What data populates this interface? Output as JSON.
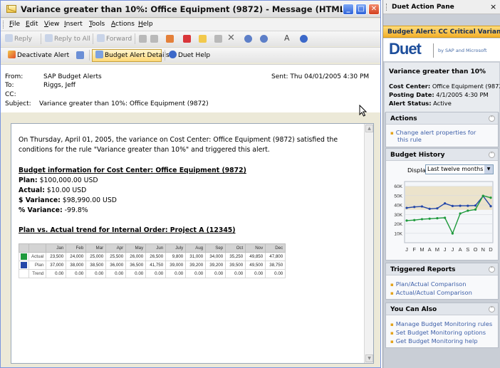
{
  "window": {
    "title": "Variance greater than 10%: Office Equipment (9872) - Message (HTML)",
    "min_glyph": "_",
    "max_glyph": "□",
    "close_glyph": "✕"
  },
  "menu": [
    "File",
    "Edit",
    "View",
    "Insert",
    "Tools",
    "Actions",
    "Help"
  ],
  "toolbar1": {
    "reply": "Reply",
    "reply_all": "Reply to All",
    "forward": "Forward",
    "font_glyph": "A"
  },
  "toolbar2": {
    "deactivate": "Deactivate Alert",
    "details": "Budget Alert Details",
    "help": "Duet Help"
  },
  "header": {
    "from_label": "From:",
    "from": "SAP Budget Alerts",
    "to_label": "To:",
    "to": "Riggs, Jeff",
    "cc_label": "CC:",
    "cc": "",
    "subject_label": "Subject:",
    "subject": "Variance greater than 10%: Office Equipment (9872)",
    "sent": "Sent: Thu 04/01/2005 4:30 PM"
  },
  "body": {
    "intro": "On Thursday, April 01, 2005, the variance on Cost Center: Office Equipment (9872) satisfied the conditions for the rule \"Variance greater than 10%\" and triggered this alert.",
    "budget_heading": "Budget information for Cost Center: Office Equipment (9872)",
    "plan_label": "Plan:",
    "plan": " $100,000.00 USD",
    "actual_label": "Actual:",
    "actual": " $10.00 USD",
    "var_label": "$ Variance:",
    "var": " $98,990.00 USD",
    "pct_label": "% Variance:",
    "pct": " -99.8%",
    "trend_heading": "Plan vs. Actual trend for Internal Order: Project A (12345)"
  },
  "trend_table": {
    "months": [
      "Jan",
      "Feb",
      "Mar",
      "Apr",
      "May",
      "Jun",
      "July",
      "Aug",
      "Sep",
      "Oct",
      "Nov",
      "Dec"
    ],
    "rows": [
      {
        "label": "Actual",
        "color": "#1e9a3c",
        "values": [
          "23,500",
          "24,000",
          "25,000",
          "25,500",
          "26,000",
          "26,500",
          "9,800",
          "31,000",
          "34,000",
          "35,250",
          "49,850",
          "47,800"
        ]
      },
      {
        "label": "Plan",
        "color": "#2346a8",
        "values": [
          "37,000",
          "38,000",
          "38,500",
          "36,000",
          "36,500",
          "41,750",
          "39,000",
          "39,200",
          "39,200",
          "39,500",
          "49,500",
          "38,750"
        ]
      },
      {
        "label": "Trend",
        "color": "",
        "values": [
          "0.00",
          "0.00",
          "0.00",
          "0.00",
          "0.00",
          "0.00",
          "0.00",
          "0.00",
          "0.00",
          "0.00",
          "0.00",
          "0.00"
        ]
      }
    ]
  },
  "duet": {
    "pane_title": "Duet Action Pane",
    "close_glyph": "×",
    "alert_title": "Budget Alert: CC Critical Variance",
    "logo": "Duet",
    "logo_tagline": "by SAP and Microsoft",
    "rule": "Variance greater than 10%",
    "cost_center_label": "Cost Center:",
    "cost_center": " Office Equipment (9872)",
    "posting_label": "Posting Date:",
    "posting": " 4/1/2005 4:30 PM",
    "status_label": "Alert Status:",
    "status": " Active",
    "actions_title": "Actions",
    "action_link_1": "Change alert properties for",
    "action_link_2": "this rule",
    "history_title": "Budget History",
    "display_label": "Display",
    "display_value": "Last twelve months",
    "reports_title": "Triggered Reports",
    "reports": [
      "Plan/Actual Comparison",
      "Actual/Actual Comparison"
    ],
    "also_title": "You Can Also",
    "also": [
      "Manage Budget Monitoring rules",
      "Set Budget Monitoring options",
      "Get Budget Monitoring help"
    ],
    "chev_glyph": "˄"
  },
  "chart_data": {
    "type": "line",
    "categories": [
      "J",
      "F",
      "M",
      "A",
      "M",
      "J",
      "J",
      "A",
      "S",
      "O",
      "N",
      "D"
    ],
    "yticks": [
      "10K",
      "20K",
      "30K",
      "40K",
      "50K",
      "60K"
    ],
    "ylim": [
      0,
      65000
    ],
    "series": [
      {
        "color": "#2346a8",
        "values": [
          37000,
          38000,
          38500,
          36000,
          36500,
          41750,
          39000,
          39200,
          39200,
          39500,
          49500,
          38750
        ]
      },
      {
        "color": "#1e9a3c",
        "values": [
          23500,
          24000,
          25000,
          25500,
          26000,
          26500,
          9800,
          31000,
          34000,
          35250,
          49850,
          47800
        ]
      }
    ]
  }
}
